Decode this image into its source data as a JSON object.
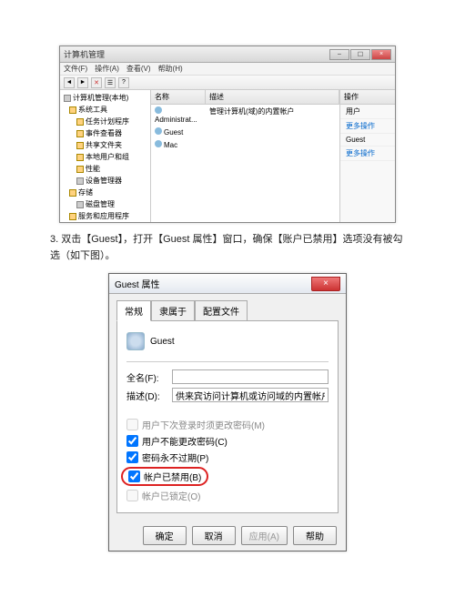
{
  "win1": {
    "title": "计算机管理",
    "menu": [
      "文件(F)",
      "操作(A)",
      "查看(V)",
      "帮助(H)"
    ],
    "tree": [
      {
        "label": "计算机管理(本地)",
        "lvl": 0,
        "ico": "gear"
      },
      {
        "label": "系统工具",
        "lvl": 1,
        "ico": "fold"
      },
      {
        "label": "任务计划程序",
        "lvl": 2,
        "ico": "fold"
      },
      {
        "label": "事件查看器",
        "lvl": 2,
        "ico": "fold"
      },
      {
        "label": "共享文件夹",
        "lvl": 2,
        "ico": "fold"
      },
      {
        "label": "本地用户和组",
        "lvl": 2,
        "ico": "fold"
      },
      {
        "label": "性能",
        "lvl": 2,
        "ico": "fold"
      },
      {
        "label": "设备管理器",
        "lvl": 2,
        "ico": "gear"
      },
      {
        "label": "存储",
        "lvl": 1,
        "ico": "fold"
      },
      {
        "label": "磁盘管理",
        "lvl": 2,
        "ico": "gear"
      },
      {
        "label": "服务和应用程序",
        "lvl": 1,
        "ico": "fold"
      }
    ],
    "listHeaders": [
      "名称",
      "描述"
    ],
    "listRows": [
      {
        "name": "Administrat...",
        "desc": "管理计算机(域)的内置帐户"
      },
      {
        "name": "Guest",
        "desc": ""
      },
      {
        "name": "Mac",
        "desc": ""
      }
    ],
    "actions": {
      "header": "操作",
      "items": [
        "用户",
        "更多操作",
        "Guest",
        "更多操作"
      ]
    }
  },
  "instruction": "3. 双击【Guest】，打开【Guest 属性】窗口，确保【账户已禁用】选项没有被勾选（如下图）。",
  "dlg2": {
    "title": "Guest 属性",
    "tabs": [
      "常规",
      "隶属于",
      "配置文件"
    ],
    "username": "Guest",
    "fullNameLabel": "全名(F):",
    "fullNameValue": "",
    "descLabel": "描述(D):",
    "descValue": "供来宾访问计算机或访问域的内置帐户",
    "checks": [
      {
        "label": "用户下次登录时须更改密码(M)",
        "checked": false,
        "disabled": true
      },
      {
        "label": "用户不能更改密码(C)",
        "checked": true,
        "disabled": false
      },
      {
        "label": "密码永不过期(P)",
        "checked": true,
        "disabled": false
      },
      {
        "label": "帐户已禁用(B)",
        "checked": true,
        "disabled": false,
        "circled": true
      },
      {
        "label": "帐户已锁定(O)",
        "checked": false,
        "disabled": true
      }
    ],
    "buttons": {
      "ok": "确定",
      "cancel": "取消",
      "apply": "应用(A)",
      "help": "帮助"
    }
  }
}
